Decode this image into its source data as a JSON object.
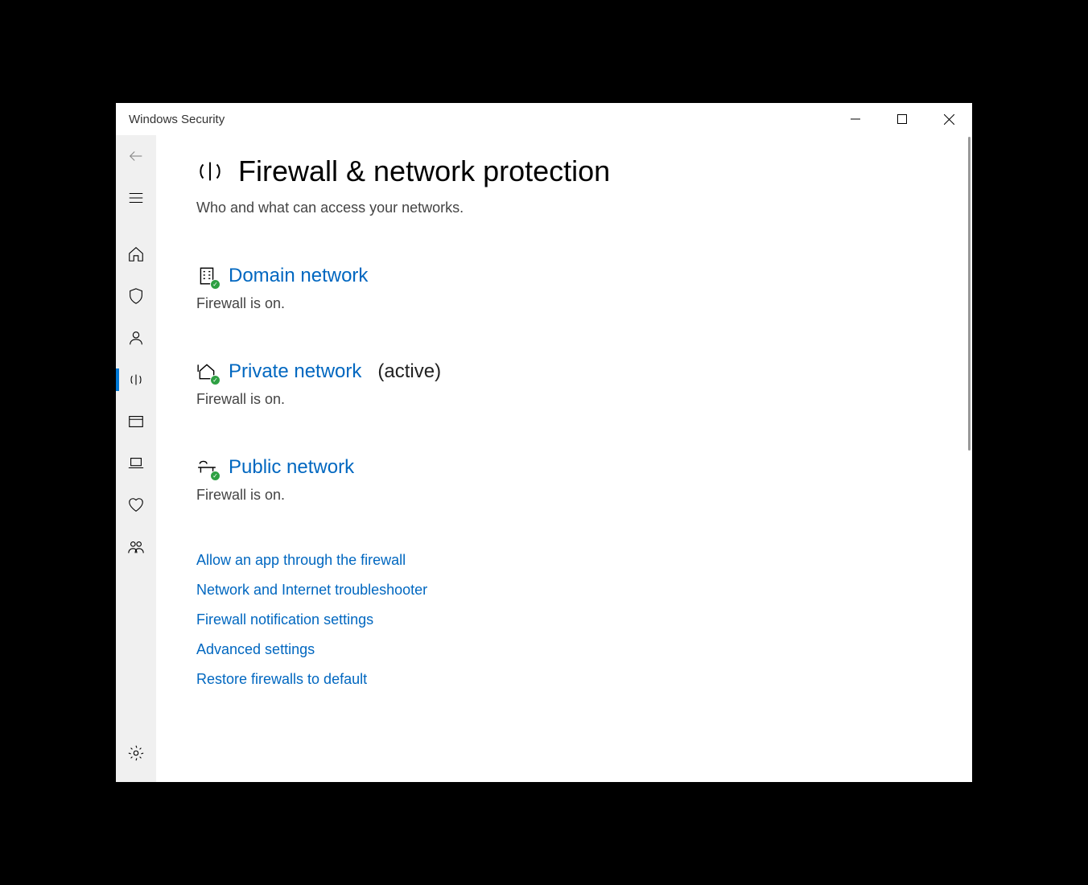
{
  "titlebar": {
    "title": "Windows Security"
  },
  "page": {
    "title": "Firewall & network protection",
    "subtitle": "Who and what can access your networks."
  },
  "networks": {
    "domain": {
      "label": "Domain network",
      "status": "Firewall is on."
    },
    "private": {
      "label": "Private network",
      "active_suffix": "(active)",
      "status": "Firewall is on."
    },
    "public": {
      "label": "Public network",
      "status": "Firewall is on."
    }
  },
  "links": {
    "allow_app": "Allow an app through the firewall",
    "troubleshooter": "Network and Internet troubleshooter",
    "notifications": "Firewall notification settings",
    "advanced": "Advanced settings",
    "restore": "Restore firewalls to default"
  }
}
